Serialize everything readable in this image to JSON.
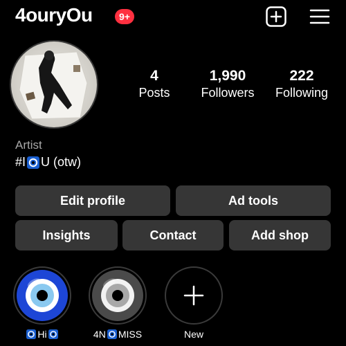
{
  "header": {
    "username": "4ouryOu",
    "notification_badge": "9+",
    "icons": {
      "create": "plus-square-icon",
      "menu": "hamburger-menu-icon"
    }
  },
  "profile": {
    "avatar": "profile-photo",
    "stats": {
      "posts": {
        "value": "4",
        "label": "Posts"
      },
      "followers": {
        "value": "1,990",
        "label": "Followers"
      },
      "following": {
        "value": "222",
        "label": "Following"
      }
    },
    "category": "Artist",
    "bio": {
      "prefix": "#I",
      "suffix": "U (otw)"
    }
  },
  "buttons": {
    "edit_profile": "Edit profile",
    "ad_tools": "Ad tools",
    "insights": "Insights",
    "contact": "Contact",
    "add_shop": "Add shop"
  },
  "highlights": [
    {
      "label_text": "Hi",
      "cover": "blue-evil-eye"
    },
    {
      "label_prefix": "4N",
      "label_suffix": "MISS",
      "cover": "gray-evil-eye"
    },
    {
      "label": "New",
      "cover": "plus-icon"
    }
  ],
  "colors": {
    "background": "#000000",
    "button": "#363636",
    "badge": "#ff3040",
    "secondary_text": "#a8a8a8"
  }
}
